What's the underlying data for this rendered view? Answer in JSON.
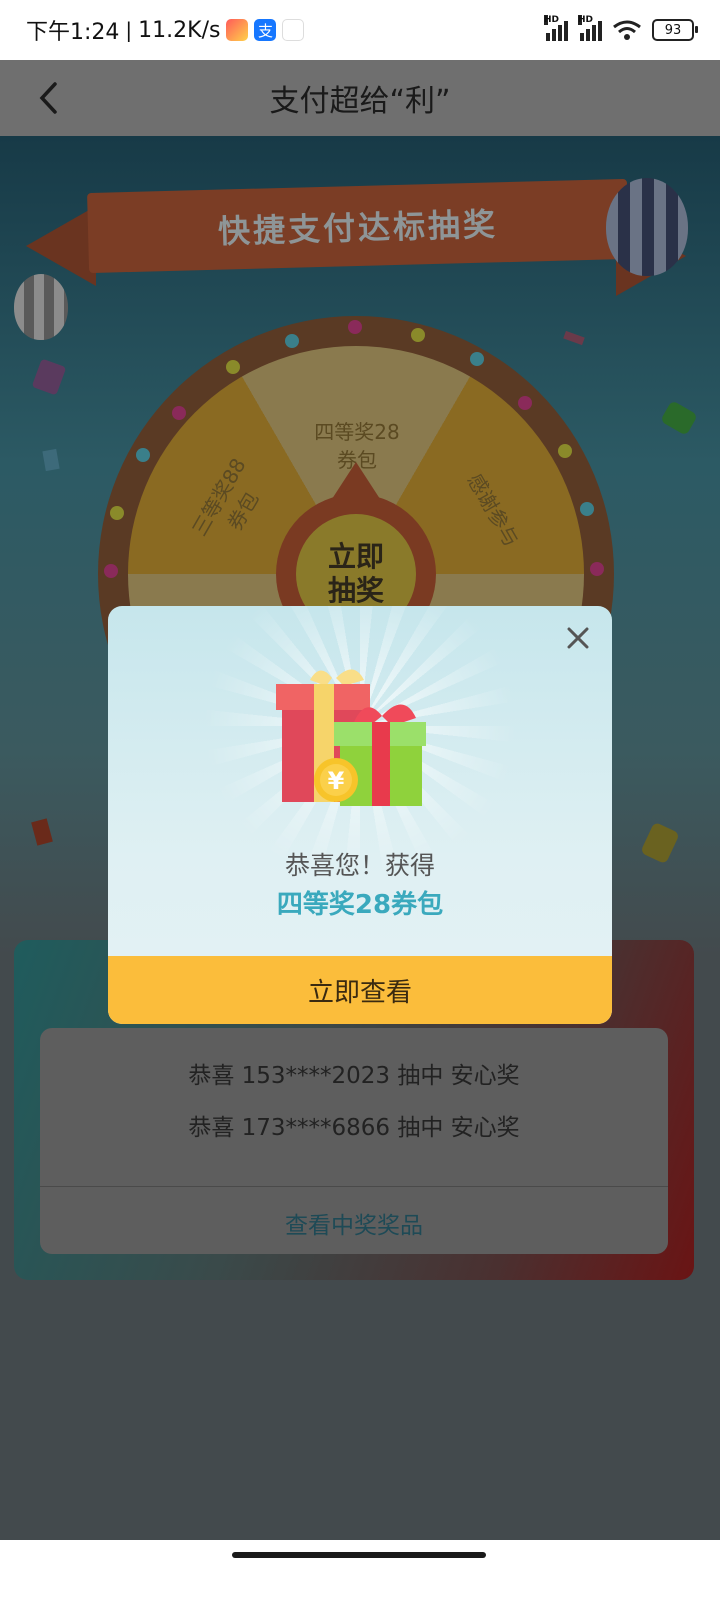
{
  "status_bar": {
    "time": "下午1:24",
    "net_speed": "11.2K/s",
    "battery": "93",
    "signal_label": "HD"
  },
  "nav": {
    "title": "支付超给“利”"
  },
  "banner": {
    "title": "快捷支付达标抽奖"
  },
  "wheel": {
    "segments": [
      "四等奖28\n券包",
      "三等奖88\n券包",
      "感谢参与"
    ],
    "center_label": "立即\n抽奖"
  },
  "records": {
    "items": [
      "恭喜 153****2023 抽中 安心奖",
      "恭喜 173****6866 抽中 安心奖"
    ],
    "link": "查看中奖奖品"
  },
  "modal": {
    "congrats": "恭喜您！获得",
    "prize": "四等奖28券包",
    "button": "立即查看",
    "coin_symbol": "¥"
  },
  "colors": {
    "accent_button": "#fbbd3b",
    "prize_text": "#3aa9bd"
  }
}
